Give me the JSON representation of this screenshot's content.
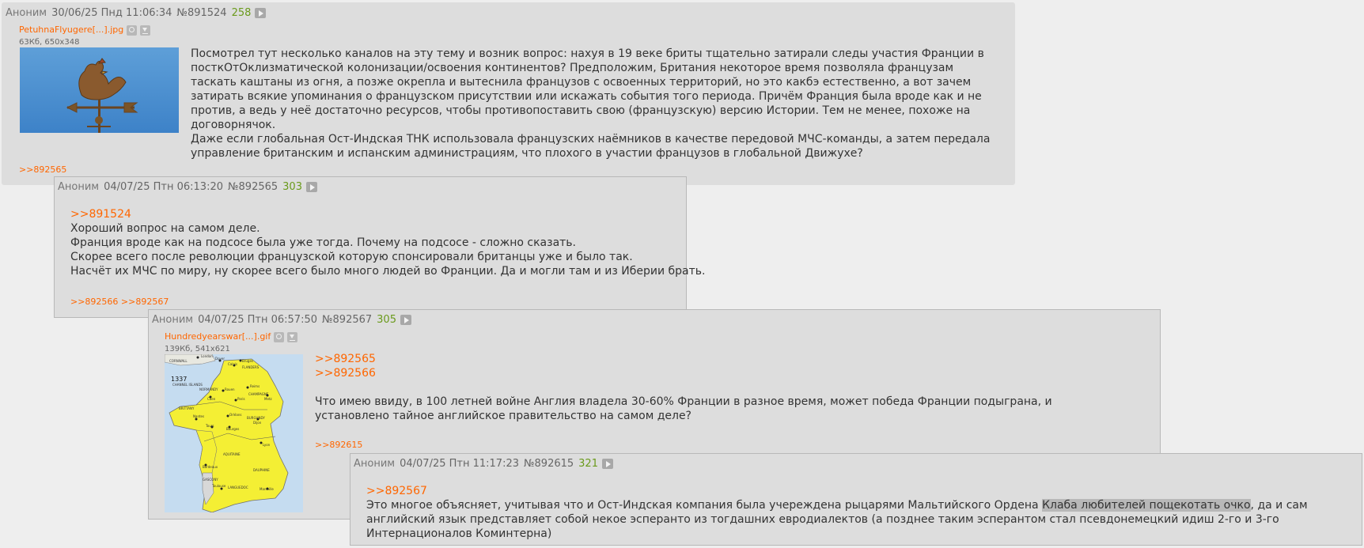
{
  "posts": [
    {
      "id": "op",
      "name": "Аноним",
      "date": "30/06/25 Пнд 11:06:34",
      "number": "№891524",
      "count": "258",
      "file": {
        "name": "PetuhnaFlyugere[...].jpg",
        "meta": "63Кб, 650x348"
      },
      "paragraphs": [
        "Посмотрел тут несколько каналов на эту тему и возник вопрос: нахуя в 19 веке бриты тщательно затирали следы участия Франции в посткОтОклизматической колонизации/освоения континентов? Предположим, Британия некоторое время позволяла французам таскать каштаны из огня, а позже окрепла и вытеснила французов с освоенных территорий, но это какбэ естественно, а вот зачем затирать всякие упоминания о французском присутствии или искажать события того периода. Причём Франция была вроде как и не против, а ведь у неё достаточно ресурсов, чтобы противопоставить свою (французскую) версию Истории. Тем не менее, похоже на договорнячок.",
        "Даже если глобальная Ост-Индская ТНК использовала французских наёмников в качестве передовой МЧС-команды, а затем передала управление британским и испанским администрациям, что плохого в участии французов в глобальной Движухе?"
      ],
      "replies": ">>892565"
    },
    {
      "id": "r1",
      "name": "Аноним",
      "date": "04/07/25 Птн 06:13:20",
      "number": "№892565",
      "count": "303",
      "quote": ">>891524",
      "lines": [
        "Хороший вопрос на самом деле.",
        "Франция вроде как на подсосе была уже тогда. Почему на подсосе - сложно сказать.",
        "Скорее всего после революции французской которую спонсировали британцы уже и было так.",
        "Насчёт их МЧС по миру, ну скорее всего было много людей во Франции. Да и могли там и из Иберии брать."
      ],
      "replies": ">>892566 >>892567"
    },
    {
      "id": "r2",
      "name": "Аноним",
      "date": "04/07/25 Птн 06:57:50",
      "number": "№892567",
      "count": "305",
      "file": {
        "name": "Hundredyearswar[...].gif",
        "meta": "139Кб, 541x621"
      },
      "quotes": [
        ">>892565",
        ">>892566"
      ],
      "body": "Что имею ввиду, в 100 летней войне Англия владела 30-60% Франции в разное время, может победа Франции подыграна, и установлено тайное английское правительство на самом деле?",
      "replies": ">>892615"
    },
    {
      "id": "r3",
      "name": "Аноним",
      "date": "04/07/25 Птн 11:17:23",
      "number": "№892615",
      "count": "321",
      "quote": ">>892567",
      "body_pre": "Это многое объясняет, учитывая что и Ост-Индская компания была учереждена рыцарями Мальтийского Ордена ",
      "body_hl": "Клаба любителей пощекотать очко",
      "body_post": ", да и сам английский язык представляет собой некое эсперанто из тогдашних евродиалектов (а позднее таким эсперантом стал псевдонемецкий идиш 2-го и 3-го Интернационалов Коминтерна)"
    }
  ],
  "map": {
    "year": "1337",
    "labels": [
      "CORNWALL",
      "London",
      "Dover",
      "Calais",
      "Bruges",
      "FLANDERS",
      "CHANNEL ISLANDS",
      "NORMANDY",
      "Rouen",
      "Reims",
      "CHAMPAGNE",
      "Caen",
      "Paris",
      "Metz",
      "BRITTANY",
      "Nantes",
      "Orléans",
      "BURGUNDY",
      "Dijon",
      "Tours",
      "Bourges",
      "Lyon",
      "AQUITAINE",
      "Bordeaux",
      "DAUPHINE",
      "GASCONY",
      "Toulouse",
      "LANGUEDOC",
      "Marseille"
    ]
  }
}
